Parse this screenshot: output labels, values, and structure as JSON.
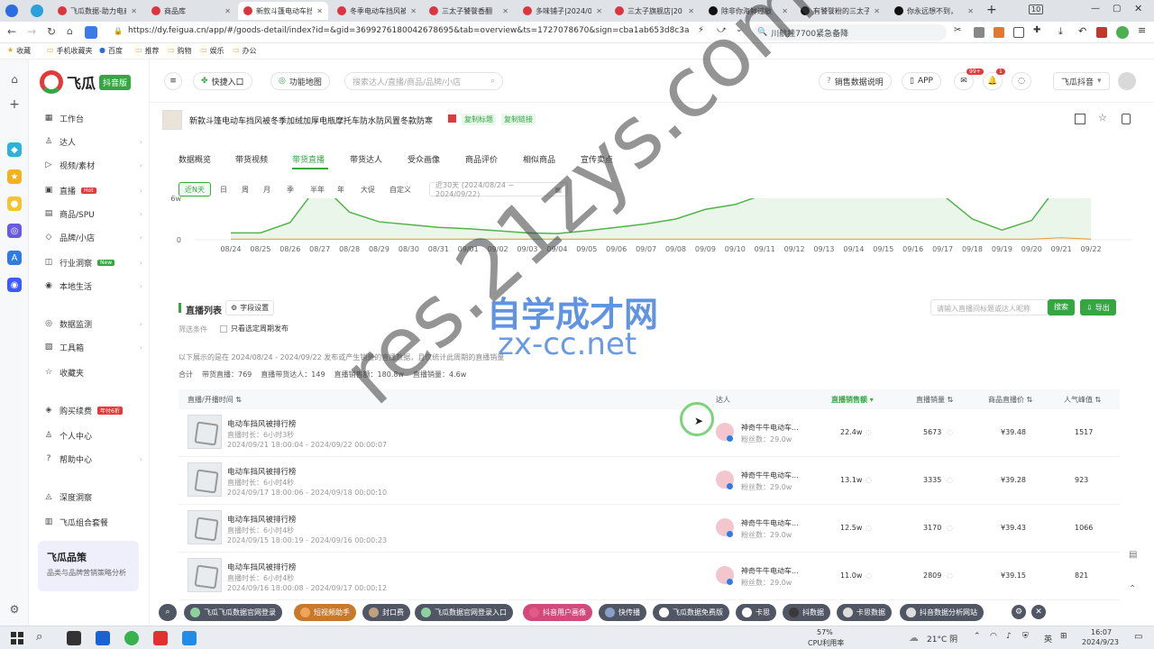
{
  "browser": {
    "tabs": [
      {
        "label": "飞瓜数据-助力电商",
        "color": "#d9363e"
      },
      {
        "label": "商品库",
        "color": "#d9363e"
      },
      {
        "label": "新款斗篷电动车挡",
        "color": "#d9363e",
        "active": true
      },
      {
        "label": "冬季电动车挡风被",
        "color": "#d9363e"
      },
      {
        "label": "三太子饕餮香翻",
        "color": "#d9363e"
      },
      {
        "label": "多味铺子|2024/0",
        "color": "#d9363e"
      },
      {
        "label": "三太子旗舰店|20",
        "color": "#d9363e"
      },
      {
        "label": "除非你海鲜过敏",
        "color": "#111"
      },
      {
        "label": "有饕餮粉的三太子",
        "color": "#111"
      },
      {
        "label": "你永远想不到，",
        "color": "#111"
      }
    ],
    "tab_count": "10",
    "url": "https://dy.feigua.cn/app/#/goods-detail/index?id=&gid=3699276180042678695&tab=overview&ts=1727078670&sign=cba1ab653d8c3a",
    "search_text": "川航挂7700紧急备降",
    "bookmarks": [
      "收藏",
      "手机收藏夹",
      "百度",
      "推荐",
      "购物",
      "娱乐",
      "办公"
    ]
  },
  "brand": {
    "name": "飞瓜",
    "sub": "抖音版"
  },
  "sidebar": {
    "items": [
      {
        "label": "工作台"
      },
      {
        "label": "达人"
      },
      {
        "label": "视频/素材"
      },
      {
        "label": "直播",
        "badge": "Hot"
      },
      {
        "label": "商品/SPU"
      },
      {
        "label": "品牌/小店"
      },
      {
        "label": "行业洞察",
        "badge": "New"
      },
      {
        "label": "本地生活"
      },
      {
        "label": "数据监测"
      },
      {
        "label": "工具箱"
      },
      {
        "label": "收藏夹"
      },
      {
        "label": "购买续费",
        "badge": "年付6折"
      },
      {
        "label": "个人中心"
      },
      {
        "label": "帮助中心"
      },
      {
        "label": "深度洞察"
      },
      {
        "label": "飞瓜组合套餐"
      }
    ],
    "promo": {
      "title": "飞瓜品策",
      "desc": "品类与品牌营销策略分析"
    }
  },
  "header": {
    "quick_entry": "快捷入口",
    "feature_map": "功能地图",
    "search_placeholder": "搜索达人/直播/商品/品牌/小店",
    "sales_note": "销售数据说明",
    "app": "APP",
    "msg_badge": "99+",
    "notice_badge": "1",
    "platform": "飞瓜抖音"
  },
  "product": {
    "title": "新款斗篷电动车挡风被冬季加绒加厚电瓶摩托车防水防风置冬款防寒",
    "copy_title": "复制标题",
    "copy_link": "复制链接"
  },
  "tabs": [
    "数据概览",
    "带货视频",
    "带货直播",
    "带货达人",
    "受众画像",
    "商品评价",
    "相似商品",
    "宣传卖点"
  ],
  "active_tab": "带货直播",
  "date_filters": [
    "近N天",
    "日",
    "周",
    "月",
    "季",
    "半年",
    "年",
    "大促",
    "自定义"
  ],
  "date_range": "近30天 (2024/08/24 ~ 2024/09/22)",
  "chart_data": {
    "type": "area",
    "x": [
      "08/24",
      "08/25",
      "08/26",
      "08/27",
      "08/28",
      "08/29",
      "08/30",
      "08/31",
      "09/01",
      "09/02",
      "09/03",
      "09/04",
      "09/05",
      "09/06",
      "09/07",
      "09/08",
      "09/09",
      "09/10",
      "09/11",
      "09/12",
      "09/13",
      "09/14",
      "09/15",
      "09/16",
      "09/17",
      "09/18",
      "09/19",
      "09/20",
      "09/21",
      "09/22"
    ],
    "y_ticks": [
      "0",
      "6w"
    ],
    "series": [
      {
        "color": "#52b34a",
        "values": [
          1.0,
          1.0,
          2.5,
          8.2,
          4.0,
          2.6,
          2.2,
          1.8,
          1.6,
          1.3,
          1.0,
          0.9,
          1.3,
          1.8,
          2.3,
          3.0,
          4.4,
          5.1,
          6.6,
          6.8,
          6.8,
          7.2,
          7.2,
          7.0,
          6.5,
          3.0,
          1.4,
          2.8,
          8.5,
          8.5
        ]
      },
      {
        "color": "#e89b3c",
        "values": [
          0.1,
          0.1,
          0.1,
          0.1,
          0.1,
          0.1,
          0.1,
          0.1,
          0.1,
          0.1,
          0.1,
          0.1,
          0.1,
          0.1,
          0.1,
          0.1,
          0.1,
          0.1,
          0.1,
          0.1,
          0.1,
          0.1,
          0.1,
          0.1,
          0.1,
          0.1,
          0.1,
          0.1,
          0.3,
          0.1
        ]
      }
    ]
  },
  "list": {
    "title": "直播列表",
    "field_settings": "字段设置",
    "filter_label": "筛选条件",
    "filter_option": "只看选定周期发布",
    "search_placeholder": "请输入直播间标题或达人昵称",
    "search_button": "搜索",
    "export_button": "导出",
    "note": "以下展示的是在 2024/08/24 - 2024/09/22 发布或产生销量的直播数据，且仅统计此周期的直播销量",
    "summary": {
      "total_label": "合计",
      "live_count": "带货直播：769",
      "talent_count": "直播带货达人：149",
      "sales_amount": "直播销售额：180.8w",
      "sales_volume": "直播销量：4.6w"
    },
    "columns": [
      "直播/开播时间",
      "达人",
      "直播销售额",
      "直播销量",
      "商品直播价",
      "人气峰值"
    ],
    "rows": [
      {
        "title": "电动车挡风被排行榜",
        "duration": "直播时长：6小时3秒",
        "time": "2024/09/21 18:00:04 - 2024/09/22 00:00:07",
        "talent": "神奇牛牛电动车...",
        "fans": "粉丝数：29.0w",
        "sales": "22.4w",
        "volume": "5673",
        "price": "¥39.48",
        "peak": "1517"
      },
      {
        "title": "电动车挡风被排行榜",
        "duration": "直播时长：6小时4秒",
        "time": "2024/09/17 18:00:06 - 2024/09/18 00:00:10",
        "talent": "神奇牛牛电动车...",
        "fans": "粉丝数：29.0w",
        "sales": "13.1w",
        "volume": "3335",
        "price": "¥39.28",
        "peak": "923"
      },
      {
        "title": "电动车挡风被排行榜",
        "duration": "直播时长：6小时4秒",
        "time": "2024/09/15 18:00:19 - 2024/09/16 00:00:23",
        "talent": "神奇牛牛电动车...",
        "fans": "粉丝数：29.0w",
        "sales": "12.5w",
        "volume": "3170",
        "price": "¥39.43",
        "peak": "1066"
      },
      {
        "title": "电动车挡风被排行榜",
        "duration": "直播时长：6小时4秒",
        "time": "2024/09/16 18:00:08 - 2024/09/17 00:00:12",
        "talent": "神奇牛牛电动车...",
        "fans": "粉丝数：29.0w",
        "sales": "11.0w",
        "volume": "2809",
        "price": "¥39.15",
        "peak": "821"
      }
    ]
  },
  "quickbar": [
    "飞瓜飞瓜数据官网登录",
    "短视频助手",
    "封口费",
    "飞瓜数据官网登录入口",
    "抖音用户画像",
    "快传播",
    "飞瓜数据免费版",
    "卡思",
    "抖数据",
    "卡思数据",
    "抖音数据分析网站"
  ],
  "taskbar": {
    "cpu": "57%",
    "cpu_label": "CPU利用率",
    "weather": "21°C 阴",
    "lang": "英",
    "time": "16:07",
    "date": "2024/9/23"
  },
  "watermark": {
    "cn": "自学成才网",
    "site": "zx-cc.net",
    "diag": "res.21zys.com"
  }
}
